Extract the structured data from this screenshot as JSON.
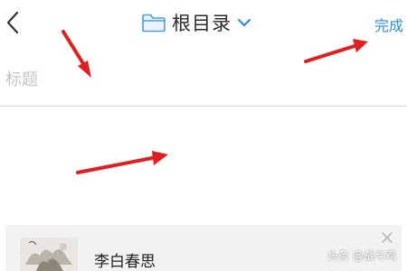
{
  "header": {
    "folder_name": "根目录",
    "done_label": "完成",
    "accent_color": "#2f8de4",
    "icons": [
      "chevron-left-icon",
      "folder-icon",
      "chevron-down-icon"
    ]
  },
  "editor": {
    "title_placeholder": "标题",
    "title_value": "",
    "body_value": ""
  },
  "attachment": {
    "title": "李白春思",
    "thumbnail_icon": "image-thumbnail-icon",
    "remove_icon": "close-icon"
  },
  "annotations": {
    "arrow_color": "#e02020",
    "arrow_count": 3
  },
  "watermark": {
    "text": "头条 @战斗鸡"
  }
}
